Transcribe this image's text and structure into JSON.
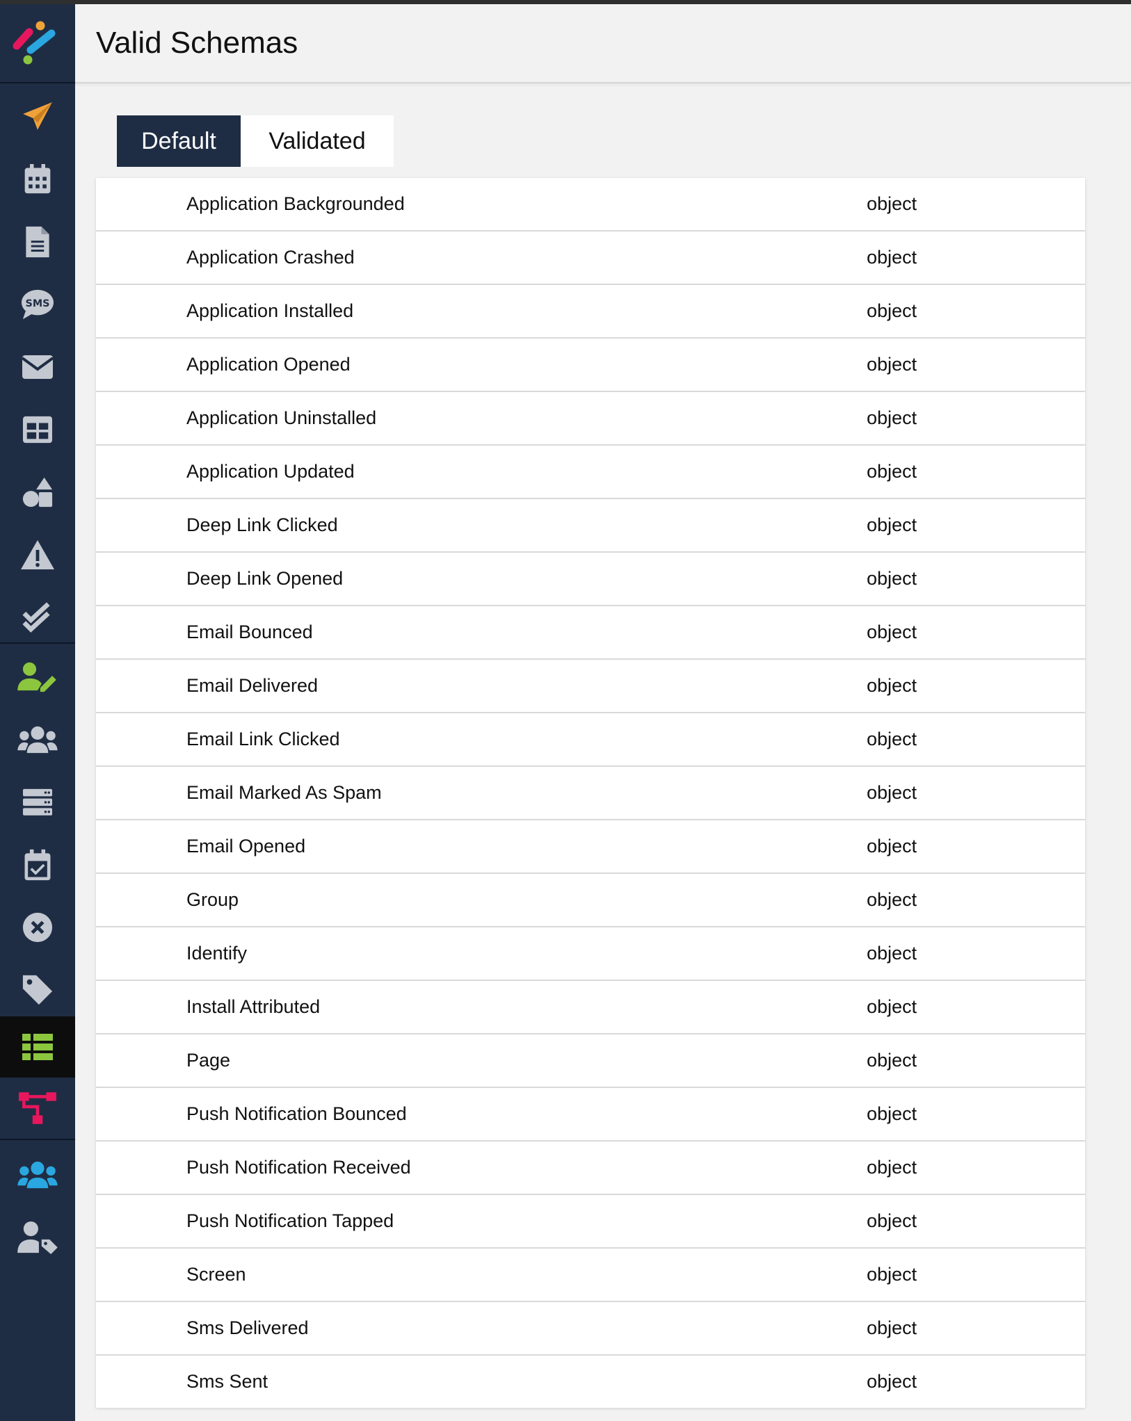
{
  "page": {
    "title": "Valid Schemas"
  },
  "tabs": [
    {
      "label": "Default",
      "active": true
    },
    {
      "label": "Validated",
      "active": false
    }
  ],
  "sidebar": {
    "items": [
      {
        "icon": "paper-plane-icon",
        "color": "#f0a23a"
      },
      {
        "icon": "calendar-icon",
        "color": "#c3c8d1"
      },
      {
        "icon": "document-icon",
        "color": "#c3c8d1"
      },
      {
        "icon": "sms-bubble-icon",
        "color": "#c3c8d1",
        "text": "SMS"
      },
      {
        "icon": "envelope-icon",
        "color": "#c3c8d1"
      },
      {
        "icon": "table-grid-icon",
        "color": "#c3c8d1"
      },
      {
        "icon": "shapes-icon",
        "color": "#c3c8d1"
      },
      {
        "icon": "warning-icon",
        "color": "#c3c8d1"
      },
      {
        "icon": "double-check-icon",
        "color": "#c3c8d1"
      },
      {
        "icon": "user-edit-icon",
        "color": "#8cc63f"
      },
      {
        "icon": "users-icon",
        "color": "#c3c8d1"
      },
      {
        "icon": "server-icon",
        "color": "#c3c8d1"
      },
      {
        "icon": "calendar-check-icon",
        "color": "#c3c8d1"
      },
      {
        "icon": "circle-x-icon",
        "color": "#c3c8d1"
      },
      {
        "icon": "tag-icon",
        "color": "#c3c8d1"
      },
      {
        "icon": "list-icon",
        "color": "#8cc63f",
        "active": true
      },
      {
        "icon": "sitemap-icon",
        "color": "#e8175d"
      },
      {
        "icon": "team-icon",
        "color": "#2aa7e0"
      },
      {
        "icon": "user-tag-icon",
        "color": "#c3c8d1"
      }
    ]
  },
  "schemas": [
    {
      "name": "Application Backgrounded",
      "type": "object"
    },
    {
      "name": "Application Crashed",
      "type": "object"
    },
    {
      "name": "Application Installed",
      "type": "object"
    },
    {
      "name": "Application Opened",
      "type": "object"
    },
    {
      "name": "Application Uninstalled",
      "type": "object"
    },
    {
      "name": "Application Updated",
      "type": "object"
    },
    {
      "name": "Deep Link Clicked",
      "type": "object"
    },
    {
      "name": "Deep Link Opened",
      "type": "object"
    },
    {
      "name": "Email Bounced",
      "type": "object"
    },
    {
      "name": "Email Delivered",
      "type": "object"
    },
    {
      "name": "Email Link Clicked",
      "type": "object"
    },
    {
      "name": "Email Marked As Spam",
      "type": "object"
    },
    {
      "name": "Email Opened",
      "type": "object"
    },
    {
      "name": "Group",
      "type": "object"
    },
    {
      "name": "Identify",
      "type": "object"
    },
    {
      "name": "Install Attributed",
      "type": "object"
    },
    {
      "name": "Page",
      "type": "object"
    },
    {
      "name": "Push Notification Bounced",
      "type": "object"
    },
    {
      "name": "Push Notification Received",
      "type": "object"
    },
    {
      "name": "Push Notification Tapped",
      "type": "object"
    },
    {
      "name": "Screen",
      "type": "object"
    },
    {
      "name": "Sms Delivered",
      "type": "object"
    },
    {
      "name": "Sms Sent",
      "type": "object"
    }
  ]
}
